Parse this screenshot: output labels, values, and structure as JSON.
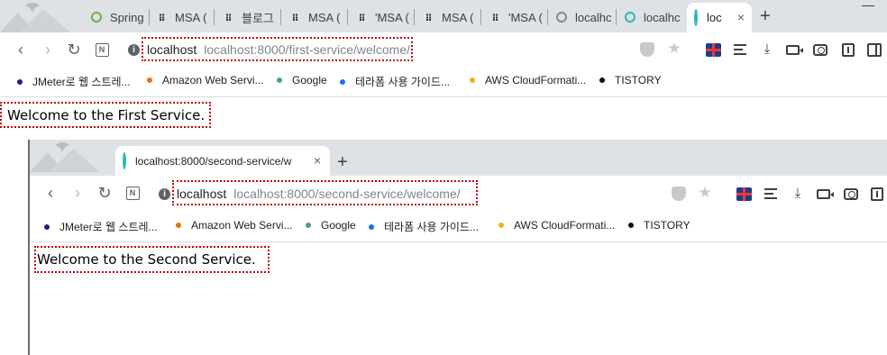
{
  "outer": {
    "tabs": [
      {
        "label": "Spring",
        "icon": "spring-icon"
      },
      {
        "label": "MSA (",
        "icon": "github-icon"
      },
      {
        "label": "블로그",
        "icon": "github-icon"
      },
      {
        "label": "MSA (",
        "icon": "github-icon"
      },
      {
        "label": "'MSA (",
        "icon": "github-icon"
      },
      {
        "label": "MSA (",
        "icon": "github-icon"
      },
      {
        "label": "'MSA (",
        "icon": "github-icon"
      },
      {
        "label": "localhc",
        "icon": "globe-icon"
      },
      {
        "label": "localhc",
        "icon": "loading-icon"
      }
    ],
    "active_tab": {
      "label": "loc",
      "close": "×"
    },
    "new_tab": "+",
    "address": {
      "host": "localhost",
      "url": "localhost:8000/first-service/welcome/"
    },
    "bookmarks": [
      {
        "label": "JMeter로 웹 스트레...",
        "color": "#1a237e"
      },
      {
        "label": "Amazon Web Servi...",
        "color": "#e8710a"
      },
      {
        "label": "Google",
        "color": "#4a9d8f"
      },
      {
        "label": "테라폼 사용 가이드...",
        "color": "#1a73e8"
      },
      {
        "label": "AWS CloudFormati...",
        "color": "#f2b01e"
      },
      {
        "label": "TISTORY",
        "color": "#111111"
      }
    ],
    "content": "Welcome to the First Service."
  },
  "inner": {
    "active_tab": {
      "label": "localhost:8000/second-service/w",
      "close": "×"
    },
    "new_tab": "+",
    "address": {
      "host": "localhost",
      "url": "localhost:8000/second-service/welcome/"
    },
    "bookmarks": [
      {
        "label": "JMeter로 웹 스트레...",
        "color": "#1a237e"
      },
      {
        "label": "Amazon Web Servi...",
        "color": "#e8710a"
      },
      {
        "label": "Google",
        "color": "#4a9d8f"
      },
      {
        "label": "테라폼 사용 가이드...",
        "color": "#1a73e8"
      },
      {
        "label": "AWS CloudFormati...",
        "color": "#f2b01e"
      },
      {
        "label": "TISTORY",
        "color": "#111111"
      }
    ],
    "content": "Welcome to the Second Service."
  },
  "colors": {
    "highlight": "#c00000",
    "tabstrip": "#dee1e6",
    "loading": "#2bbbad"
  }
}
